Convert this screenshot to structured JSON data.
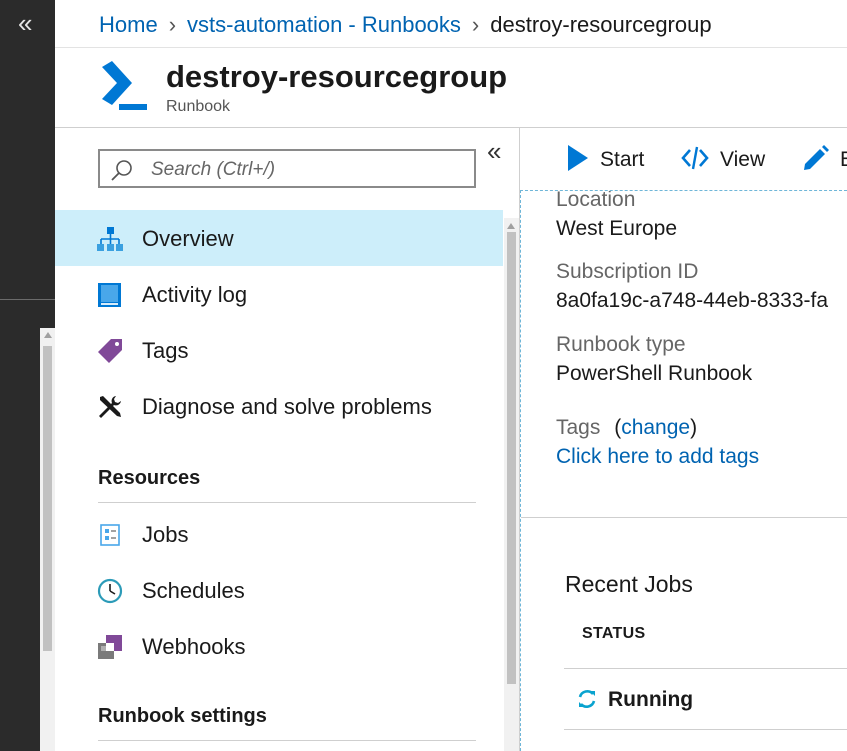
{
  "breadcrumb": {
    "home": "Home",
    "parent": "vsts-automation - Runbooks",
    "current": "destroy-resourcegroup",
    "separator": "›"
  },
  "header": {
    "title": "destroy-resourcegroup",
    "subtitle": "Runbook",
    "icon": "powershell-icon"
  },
  "nav": {
    "search_placeholder": "Search (Ctrl+/)",
    "collapse_glyph": "«",
    "items": [
      {
        "label": "Overview",
        "icon": "hierarchy-icon",
        "selected": true
      },
      {
        "label": "Activity log",
        "icon": "book-icon"
      },
      {
        "label": "Tags",
        "icon": "tag-icon"
      },
      {
        "label": "Diagnose and solve problems",
        "icon": "tools-icon"
      }
    ],
    "sections": [
      {
        "title": "Resources",
        "items": [
          {
            "label": "Jobs",
            "icon": "jobs-icon"
          },
          {
            "label": "Schedules",
            "icon": "clock-icon"
          },
          {
            "label": "Webhooks",
            "icon": "webhook-icon"
          }
        ]
      },
      {
        "title": "Runbook settings",
        "items": []
      }
    ]
  },
  "sidebar": {
    "collapse_glyph": "«"
  },
  "toolbar": {
    "start_label": "Start",
    "view_label": "View",
    "edit_label": "E"
  },
  "essentials": {
    "location_label": "Location",
    "location_value": "West Europe",
    "subscription_label": "Subscription ID",
    "subscription_value": "8a0fa19c-a748-44eb-8333-fa",
    "type_label": "Runbook type",
    "type_value": "PowerShell Runbook",
    "tags_label": "Tags",
    "tags_open": "(",
    "tags_change": "change",
    "tags_close": ")",
    "tags_add": "Click here to add tags"
  },
  "recent_jobs": {
    "title": "Recent Jobs",
    "status_header": "STATUS",
    "rows": [
      {
        "status": "Running",
        "icon": "refresh-icon"
      }
    ]
  },
  "colors": {
    "accent": "#0063b1",
    "selected_bg": "#cdeefa",
    "left_strip": "#2b2b2b",
    "icon_blue": "#0078d4",
    "tag_purple": "#804998"
  }
}
